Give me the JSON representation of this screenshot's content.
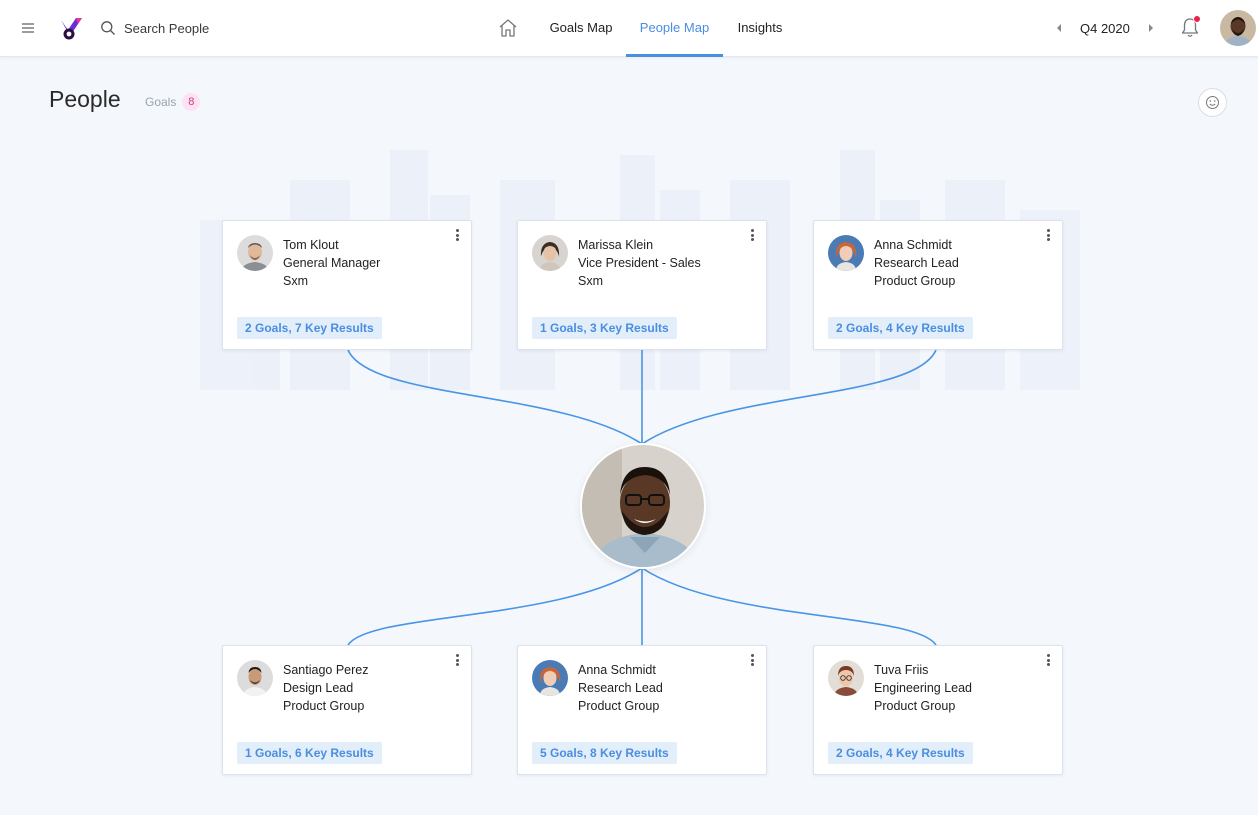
{
  "colors": {
    "accent": "#4a90e2",
    "stats_bg": "#e3eefb",
    "badge_bg": "#fde3f2",
    "badge_text": "#d0388a",
    "notification": "#e8234a",
    "logo_purple": "#6b2bd9",
    "logo_pink": "#e8349a"
  },
  "topbar": {
    "search_placeholder": "Search People",
    "nav": [
      {
        "label": "Goals Map",
        "active": false
      },
      {
        "label": "People Map",
        "active": true
      },
      {
        "label": "Insights",
        "active": false
      }
    ],
    "quarter": "Q4 2020",
    "icons": [
      "hamburger-icon",
      "search-icon",
      "home-icon",
      "chevron-left-icon",
      "chevron-right-icon",
      "bell-icon"
    ]
  },
  "header": {
    "title": "People",
    "goals_label": "Goals",
    "goals_count": "8"
  },
  "managers": [
    {
      "name": "Tom Klout",
      "role": "General Manager",
      "group": "Sxm",
      "stats": "2 Goals, 7 Key Results"
    },
    {
      "name": "Marissa Klein",
      "role": "Vice President - Sales",
      "group": "Sxm",
      "stats": "1 Goals, 3 Key Results"
    },
    {
      "name": "Anna Schmidt",
      "role": "Research Lead",
      "group": "Product Group",
      "stats": "2 Goals, 4 Key Results"
    }
  ],
  "reports": [
    {
      "name": "Santiago Perez",
      "role": "Design Lead",
      "group": "Product Group",
      "stats": "1 Goals, 6 Key Results"
    },
    {
      "name": "Anna Schmidt",
      "role": "Research Lead",
      "group": "Product Group",
      "stats": "5 Goals, 8 Key Results"
    },
    {
      "name": "Tuva Friis",
      "role": "Engineering Lead",
      "group": "Product Group",
      "stats": "2 Goals, 4 Key Results"
    }
  ]
}
